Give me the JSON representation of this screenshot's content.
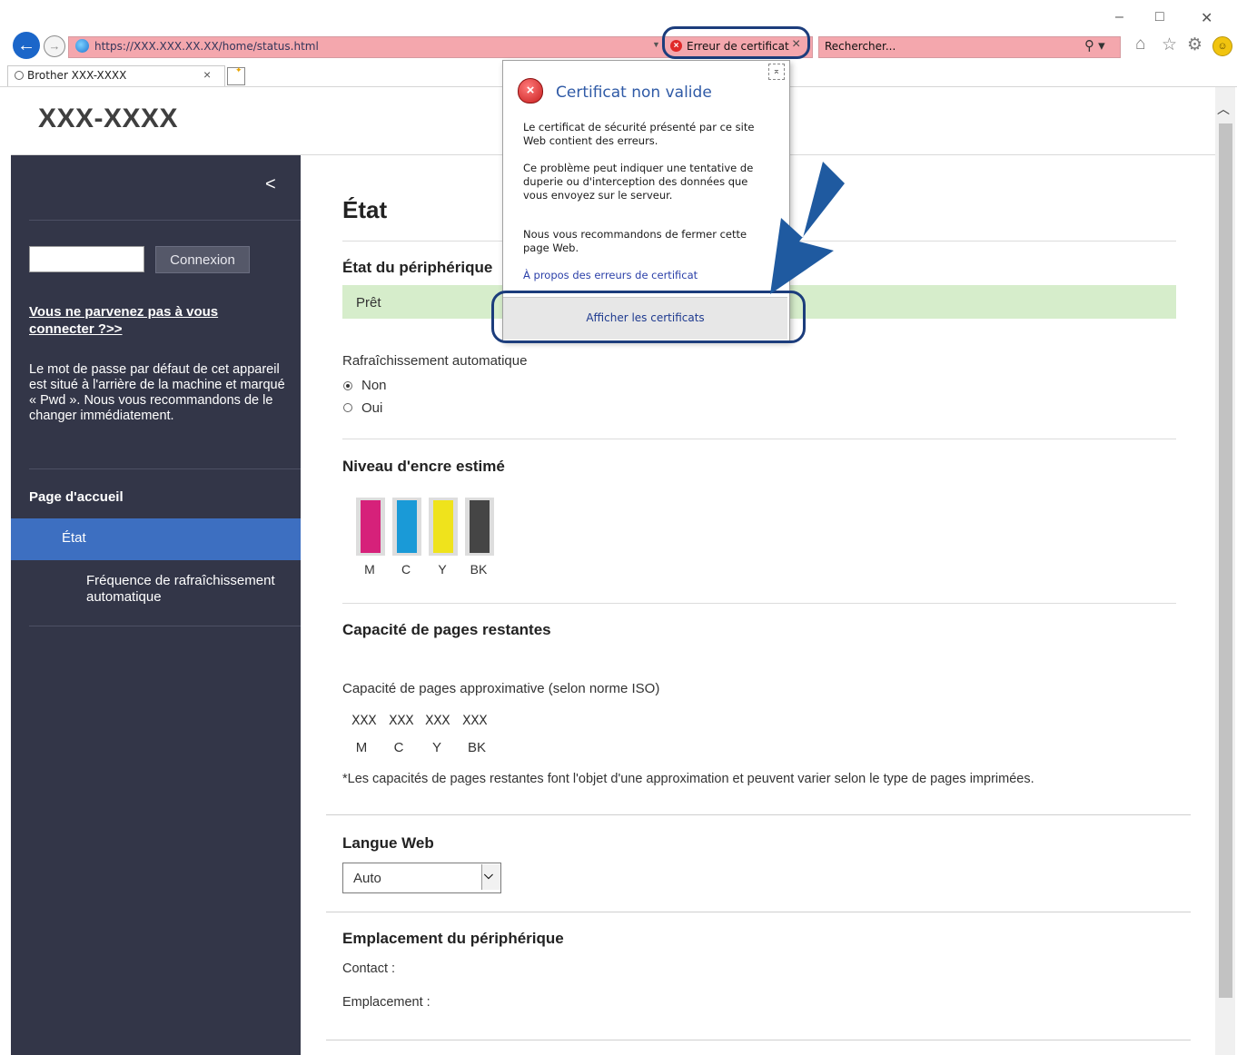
{
  "browser": {
    "address_url": "https://XXX.XXX.XX.XX/home/status.html",
    "cert_error_label": "Erreur de certificat",
    "search_placeholder": "Rechercher...",
    "tab_title": "Brother XXX-XXXX",
    "icons": [
      "back-icon",
      "forward-icon",
      "ie-icon",
      "search-icon",
      "home-icon",
      "favorites-star-icon",
      "settings-gear-icon",
      "feedback-smiley-icon",
      "minimize-icon",
      "maximize-icon",
      "close-icon",
      "new-tab-icon"
    ]
  },
  "cert_popup": {
    "title": "Certificat non valide",
    "para1": "Le certificat de sécurité présenté par ce site Web contient des erreurs.",
    "para2": "Ce problème peut indiquer une tentative de duperie ou d'interception des données que vous envoyez sur le serveur.",
    "para3": "Nous vous recommandons de fermer cette page Web.",
    "link": "À propos des erreurs de certificat",
    "button": "Afficher les certificats",
    "highlight_color": "#1c3d7c",
    "arrow_color": "#1f5aa0"
  },
  "header": {
    "logo": "XXX-XXXX"
  },
  "sidebar": {
    "collapse_glyph": "<",
    "login_button": "Connexion",
    "help_link": "Vous ne parvenez pas à vous connecter ?>>",
    "password_note": "Le mot de passe par défaut de cet appareil est situé à l'arrière de la machine et marqué « Pwd ». Nous vous recommandons de le changer immédiatement.",
    "home": "Page d'accueil",
    "active_item": "État",
    "sub_item": "Fréquence de rafraîchissement automatique",
    "bg_color": "#333648",
    "active_color": "#3d6fc1"
  },
  "main": {
    "title": "État",
    "device_status_title": "État du périphérique",
    "device_status": "Prêt",
    "refresh_title": "Rafraîchissement automatique",
    "refresh_options": [
      "Non",
      "Oui"
    ],
    "refresh_selected": "Non",
    "ink_title": "Niveau d'encre estimé",
    "ink": [
      {
        "label": "M",
        "color": "#d6217a",
        "level": 1.0
      },
      {
        "label": "C",
        "color": "#1a9ad7",
        "level": 1.0
      },
      {
        "label": "Y",
        "color": "#efe31c",
        "level": 1.0
      },
      {
        "label": "BK",
        "color": "#454545",
        "level": 1.0
      }
    ],
    "pages_title": "Capacité de pages restantes",
    "pages_subtitle": "Capacité de pages approximative (selon norme ISO)",
    "pages_values": [
      "XXX",
      "XXX",
      "XXX",
      "XXX"
    ],
    "pages_labels": [
      "M",
      "C",
      "Y",
      "BK"
    ],
    "pages_note": "*Les capacités de pages restantes font l'objet d'une approximation et peuvent varier selon le type de pages imprimées.",
    "lang_title": "Langue Web",
    "lang_value": "Auto",
    "location_title": "Emplacement du périphérique",
    "contact_label": "Contact :",
    "location_label": "Emplacement :",
    "status_color": "#d6edcb"
  }
}
